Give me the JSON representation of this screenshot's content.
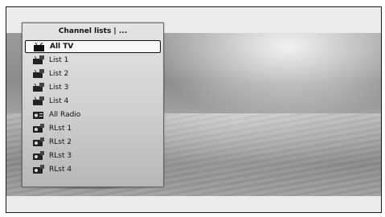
{
  "menu": {
    "title": "Channel lists | ...",
    "items": [
      {
        "label": "All TV",
        "icon": "tv-icon",
        "selected": true
      },
      {
        "label": "List 1",
        "icon": "tv-list-icon"
      },
      {
        "label": "List 2",
        "icon": "tv-list-icon"
      },
      {
        "label": "List 3",
        "icon": "tv-list-icon"
      },
      {
        "label": "List 4",
        "icon": "tv-list-icon"
      },
      {
        "label": "All Radio",
        "icon": "radio-icon"
      },
      {
        "label": "RLst 1",
        "icon": "radio-list-icon"
      },
      {
        "label": "RLst 2",
        "icon": "radio-list-icon"
      },
      {
        "label": "RLst 3",
        "icon": "radio-list-icon"
      },
      {
        "label": "RLst 4",
        "icon": "radio-list-icon"
      }
    ]
  }
}
